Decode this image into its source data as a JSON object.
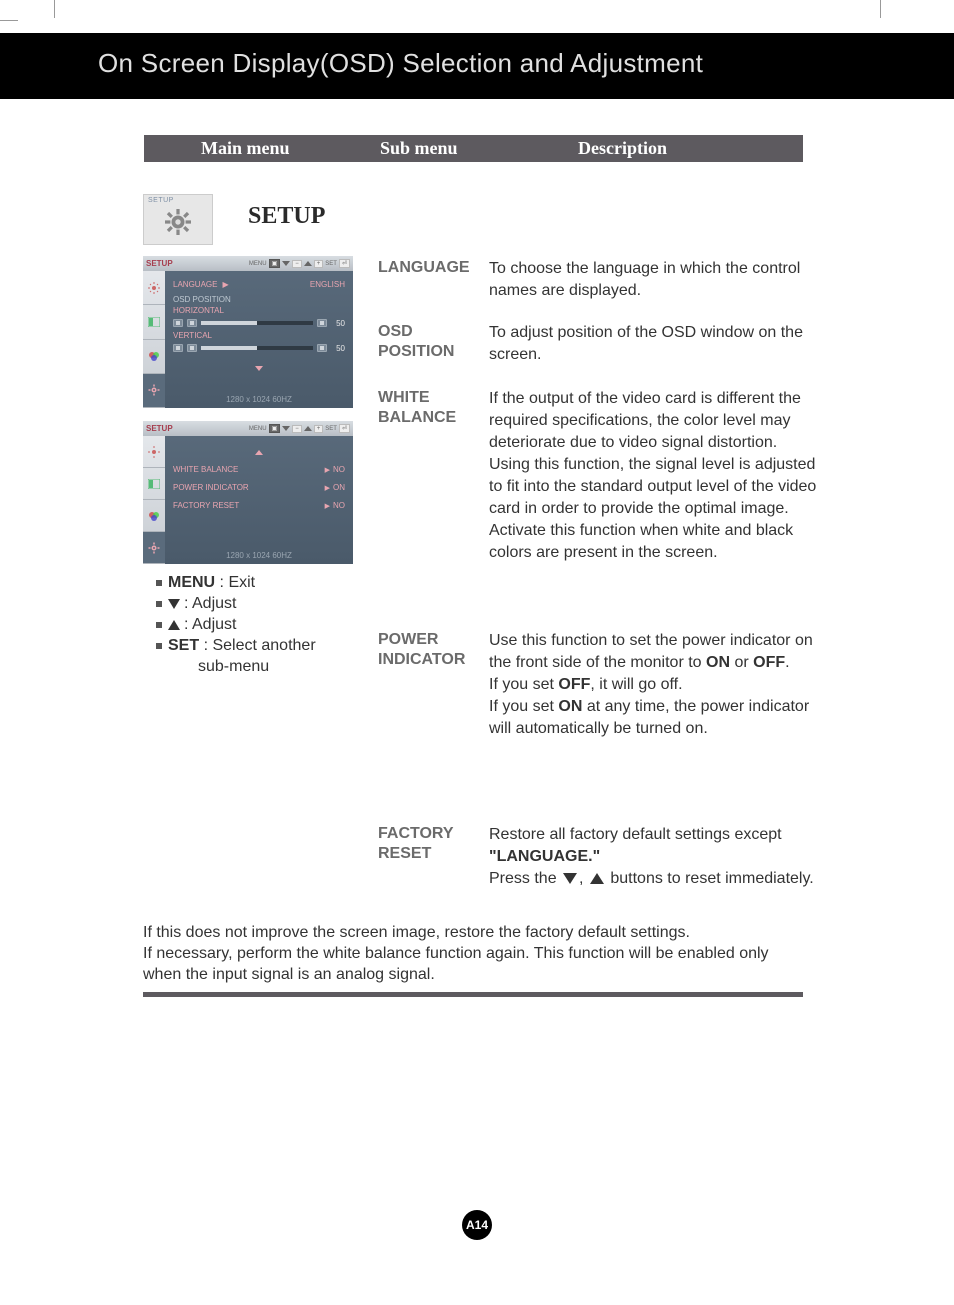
{
  "page": {
    "title": "On Screen Display(OSD) Selection and Adjustment",
    "number": "A14"
  },
  "columns": {
    "main": "Main menu",
    "sub": "Sub menu",
    "desc": "Description"
  },
  "setup": {
    "icon_label": "SETUP",
    "heading": "SETUP"
  },
  "osd1": {
    "title": "SETUP",
    "nav": {
      "menu": "MENU",
      "set": "SET"
    },
    "language_label": "LANGUAGE",
    "language_value": "ENGLISH",
    "section": "OSD  POSITION",
    "horizontal": "HORIZONTAL",
    "vertical": "VERTICAL",
    "h_val": "50",
    "v_val": "50",
    "resolution": "1280 x 1024  60HZ"
  },
  "osd2": {
    "title": "SETUP",
    "nav": {
      "menu": "MENU",
      "set": "SET"
    },
    "rows": [
      {
        "label": "WHITE  BALANCE",
        "value": "NO"
      },
      {
        "label": "POWER  INDICATOR",
        "value": "ON"
      },
      {
        "label": "FACTORY  RESET",
        "value": "NO"
      }
    ],
    "resolution": "1280 x 1024  60HZ"
  },
  "legend": {
    "menu_key": "MENU",
    "menu_txt": " : Exit",
    "down_txt": " : Adjust",
    "up_txt": " : Adjust",
    "set_key": "SET",
    "set_txt": " : Select another",
    "set_txt2": "sub-menu"
  },
  "subs": {
    "language": "LANGUAGE",
    "osd_pos1": "OSD",
    "osd_pos2": "POSITION",
    "wb1": "WHITE",
    "wb2": "BALANCE",
    "pi1": "POWER",
    "pi2": "INDICATOR",
    "fr1": "FACTORY",
    "fr2": "RESET"
  },
  "descs": {
    "language": "To choose the language in which the control names are displayed.",
    "osd_pos": "To adjust position of the OSD window on the screen.",
    "wb": "If the output of the video card is different the required specifications, the color level may deteriorate due to video signal distortion. Using this function, the signal level is adjusted to fit into the standard output level of the video card in order to provide the optimal image. Activate this function when white and black colors are present in the screen.",
    "pi_1": "Use this function to set the power indicator on the front side of the monitor to ",
    "pi_on": "ON",
    "pi_or": " or ",
    "pi_off": "OFF",
    "pi_2": ".",
    "pi_3a": "If you set ",
    "pi_3b": ", it will go off.",
    "pi_4a": "If you set ",
    "pi_4b": " at any time, the power indicator will automatically be turned on.",
    "fr_1": "Restore all factory default settings except ",
    "fr_lang": "\"LANGUAGE.\"",
    "fr_2a": "Press the ",
    "fr_2b": ", ",
    "fr_2c": " buttons to reset immediately."
  },
  "footnote": {
    "line1": "If this does not improve the screen image, restore the factory default settings.",
    "line2": "If necessary, perform the white balance function again. This function will be enabled only when the input signal is an analog signal."
  }
}
